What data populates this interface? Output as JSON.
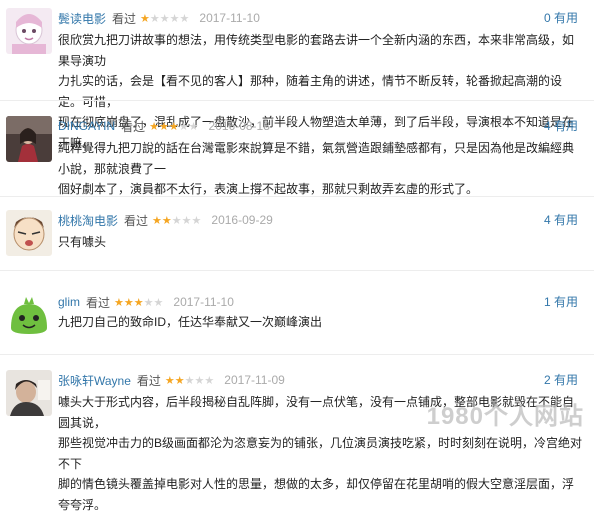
{
  "reviews": [
    {
      "user": "鬓读电影",
      "seen": "看过",
      "rating": 1,
      "date": "2017-11-10",
      "useful": "0 有用",
      "lines": [
        "很欣赏九把刀讲故事的想法，用传统类型电影的套路去讲一个全新内涵的东西，本来非常高级，如果导演功",
        "力扎实的话，会是【看不见的客人】那种，随着主角的讲述，情节不断反转，轮番掀起高潮的设定。可惜，",
        "现在彻底崩盘了，混乱成了一盘散沙，前半段人物塑造太单薄，到了后半段，导演根本不知道是在干嘛。"
      ]
    },
    {
      "user": "DINGAYIN",
      "seen": "看过",
      "rating": 3,
      "date": "2016-08-18",
      "useful": "4 有用",
      "lines": [
        "純粹覺得九把刀說的話在台灣電影來說算是不錯，氣氛營造跟鋪墊感都有，只是因為他是改編經典小說，那就浪費了一",
        "個好劇本了，演員都不太行，表演上撐不起故事，那就只剩故弄玄虛的形式了。"
      ]
    },
    {
      "user": "桃桃淘电影",
      "seen": "看过",
      "rating": 2,
      "date": "2016-09-29",
      "useful": "4 有用",
      "lines": [
        "只有噱头"
      ]
    },
    {
      "user": "glim",
      "seen": "看过",
      "rating": 3,
      "date": "2017-11-10",
      "useful": "1 有用",
      "lines": [
        "九把刀自己的致命ID，任达华奉献又一次巅峰演出"
      ]
    },
    {
      "user": "张咏轩Wayne",
      "seen": "看过",
      "rating": 2,
      "date": "2017-11-09",
      "useful": "2 有用",
      "lines": [
        "噱头大于形式内容，后半段揭秘自乱阵脚，没有一点伏笔，没有一点铺成，整部电影就毁在不能自圆其说，",
        "那些视觉冲击力的B级画面都沦为恣意妄为的铺张，几位演员演技吃紧，时时刻刻在说明，冷宫绝对不下",
        "脚的情色镜头覆盖掉电影对人性的思量，想做的太多，却仅停留在花里胡哨的假大空意淫层面，浮夸夸浮。"
      ]
    }
  ],
  "watermark": "1980个人网站",
  "colors": {
    "link": "#3377aa",
    "star": "#f5a623",
    "date": "#aaaaaa"
  }
}
